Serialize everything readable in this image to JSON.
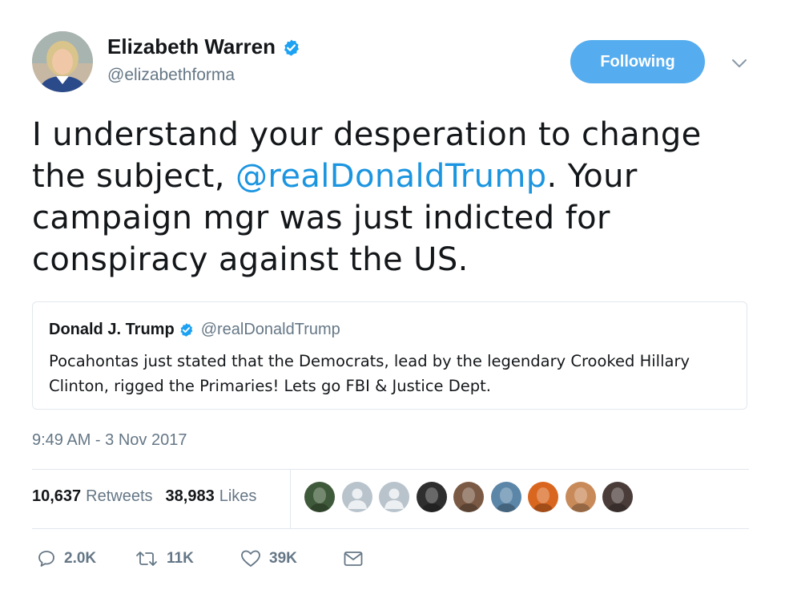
{
  "author": {
    "name": "Elizabeth Warren",
    "handle": "@elizabethforma",
    "verified": true,
    "avatar_icon": "profile-photo"
  },
  "follow_button": {
    "label": "Following"
  },
  "menu": {
    "icon": "chevron-down-icon"
  },
  "tweet": {
    "text_before": "I understand your desperation to change the subject, ",
    "mention": "@realDonaldTrump",
    "text_after": ". Your campaign mgr was just indicted for conspiracy against the US."
  },
  "quoted_tweet": {
    "name": "Donald J. Trump",
    "handle": "@realDonaldTrump",
    "verified": true,
    "text": "Pocahontas just stated that the Democrats, lead by the legendary Crooked Hillary Clinton, rigged the Primaries! Lets go FBI & Justice Dept."
  },
  "timestamp": "9:49 AM - 3 Nov 2017",
  "stats": {
    "retweets_count": "10,637",
    "retweets_label": "Retweets",
    "likes_count": "38,983",
    "likes_label": "Likes"
  },
  "liker_avatars": [
    {
      "icon": "photo-avatar",
      "color": "#3f5a3a"
    },
    {
      "icon": "default-avatar",
      "color": "#b8c3cc"
    },
    {
      "icon": "default-avatar",
      "color": "#b8c3cc"
    },
    {
      "icon": "photo-avatar",
      "color": "#2e2e2e"
    },
    {
      "icon": "photo-avatar",
      "color": "#7a5a44"
    },
    {
      "icon": "photo-avatar",
      "color": "#5b86a8"
    },
    {
      "icon": "photo-avatar",
      "color": "#d9661f"
    },
    {
      "icon": "photo-avatar",
      "color": "#c98a5a"
    },
    {
      "icon": "photo-avatar",
      "color": "#4a3c38"
    }
  ],
  "actions": {
    "reply_count": "2.0K",
    "retweet_count": "11K",
    "like_count": "39K"
  },
  "colors": {
    "accent": "#1b95e0",
    "button": "#55acee",
    "muted": "#657786",
    "border": "#e1e8ed"
  }
}
